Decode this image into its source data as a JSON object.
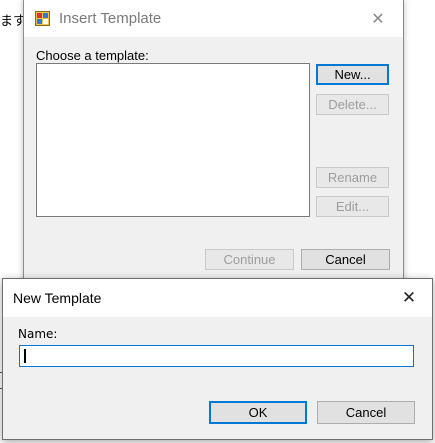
{
  "background": {
    "partial_text_top": "ます"
  },
  "insert_template_dialog": {
    "title": "Insert Template",
    "icon": "app-window-icon",
    "close_glyph": "✕",
    "list_label": "Choose a template:",
    "templates": [],
    "buttons": {
      "new": "New...",
      "delete": "Delete...",
      "rename": "Rename",
      "edit": "Edit...",
      "continue": "Continue",
      "cancel": "Cancel"
    }
  },
  "new_template_dialog": {
    "title": "New Template",
    "close_glyph": "✕",
    "name_label": "Name:",
    "name_value": "",
    "buttons": {
      "ok": "OK",
      "cancel": "Cancel"
    }
  },
  "colors": {
    "accent": "#0078d7",
    "dialog_bg": "#f0f0f0",
    "disabled_text": "#9d9d9d"
  }
}
